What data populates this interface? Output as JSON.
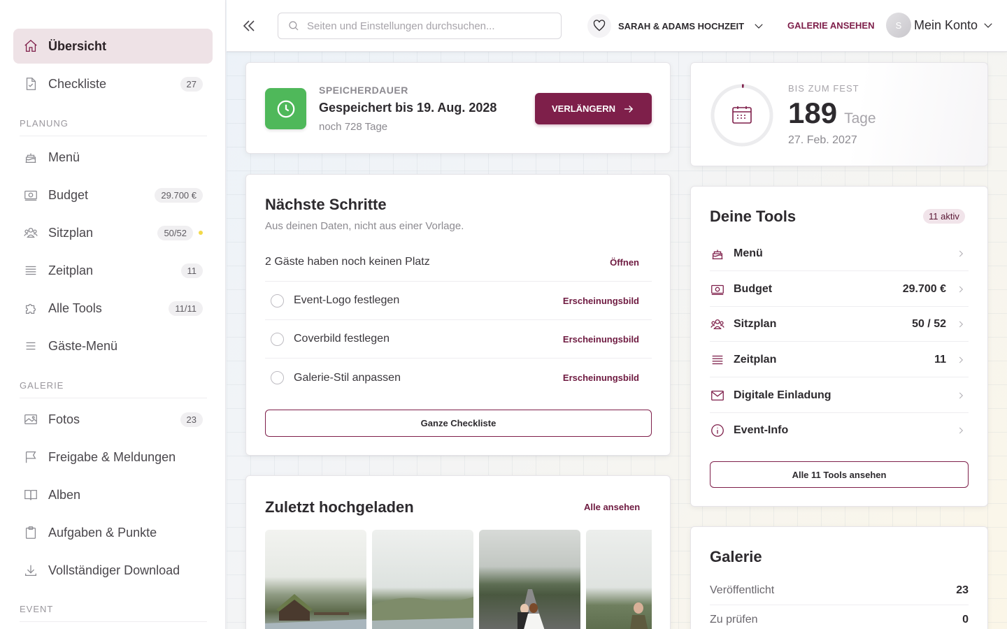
{
  "sidebar": {
    "items_top": [
      {
        "label": "Übersicht",
        "icon": "home-icon",
        "active": true
      },
      {
        "label": "Checkliste",
        "icon": "document-icon",
        "badge": "27"
      }
    ],
    "sections": [
      {
        "label": "PLANUNG"
      },
      {
        "label": "GALERIE"
      },
      {
        "label": "EVENT"
      }
    ],
    "planung_items": [
      {
        "label": "Menü",
        "icon": "cake-icon"
      },
      {
        "label": "Budget",
        "icon": "money-icon",
        "badge": "29.700 €"
      },
      {
        "label": "Sitzplan",
        "icon": "people-icon",
        "badge": "50/52"
      },
      {
        "label": "Zeitplan",
        "icon": "list-icon",
        "badge": "11"
      },
      {
        "label": "Alle Tools",
        "icon": "puzzle-icon",
        "badge": "11/11"
      },
      {
        "label": "Gäste-Menü",
        "icon": "menu-icon"
      }
    ],
    "galerie_items": [
      {
        "label": "Fotos",
        "icon": "image-icon",
        "badge": "23"
      },
      {
        "label": "Freigabe & Meldungen",
        "icon": "flag-icon"
      },
      {
        "label": "Alben",
        "icon": "book-icon"
      },
      {
        "label": "Aufgaben & Punkte",
        "icon": "clipboard-icon"
      },
      {
        "label": "Vollständiger Download",
        "icon": "download-icon"
      }
    ]
  },
  "header": {
    "search_placeholder": "Seiten und Einstellungen durchsuchen...",
    "event_name": "SARAH & ADAMS HOCHZEIT",
    "gallery_link": "GALERIE ANSEHEN",
    "avatar_initial": "S",
    "account_label": "Mein Konto"
  },
  "storage": {
    "kicker": "SPEICHERDAUER",
    "title": "Gespeichert bis 19. Aug. 2028",
    "remaining": "noch 728 Tage",
    "button": "VERLÄNGERN"
  },
  "countdown": {
    "kicker": "BIS ZUM FEST",
    "days": "189",
    "unit": "Tage",
    "date": "27. Feb. 2027",
    "progress": 0.01
  },
  "next_steps": {
    "title": "Nächste Schritte",
    "subtitle": "Aus deinen Daten, nicht aus einer Vorlage.",
    "info_row": {
      "text": "2 Gäste haben noch keinen Platz",
      "action": "Öffnen"
    },
    "tasks": [
      {
        "text": "Event-Logo festlegen",
        "action": "Erscheinungsbild"
      },
      {
        "text": "Coverbild festlegen",
        "action": "Erscheinungsbild"
      },
      {
        "text": "Galerie-Stil anpassen",
        "action": "Erscheinungsbild"
      }
    ],
    "button": "Ganze Checkliste"
  },
  "uploads": {
    "title": "Zuletzt hochgeladen",
    "link": "Alle ansehen"
  },
  "tools": {
    "title": "Deine Tools",
    "badge": "11 aktiv",
    "rows": [
      {
        "name": "Menü",
        "value": "",
        "icon": "cake-icon"
      },
      {
        "name": "Budget",
        "value": "29.700 €",
        "icon": "money-icon"
      },
      {
        "name": "Sitzplan",
        "value": "50 / 52",
        "icon": "people-icon"
      },
      {
        "name": "Zeitplan",
        "value": "11",
        "icon": "list-icon"
      },
      {
        "name": "Digitale Einladung",
        "value": "",
        "icon": "envelope-icon"
      },
      {
        "name": "Event-Info",
        "value": "",
        "icon": "info-icon"
      }
    ],
    "button": "Alle 11 Tools ansehen"
  },
  "gallery": {
    "title": "Galerie",
    "rows": [
      {
        "label": "Veröffentlicht",
        "value": "23"
      },
      {
        "label": "Zu prüfen",
        "value": "0"
      }
    ]
  },
  "colors": {
    "accent": "#7e1f4a",
    "green": "#4fb85a",
    "dot": "#f2d94a"
  }
}
